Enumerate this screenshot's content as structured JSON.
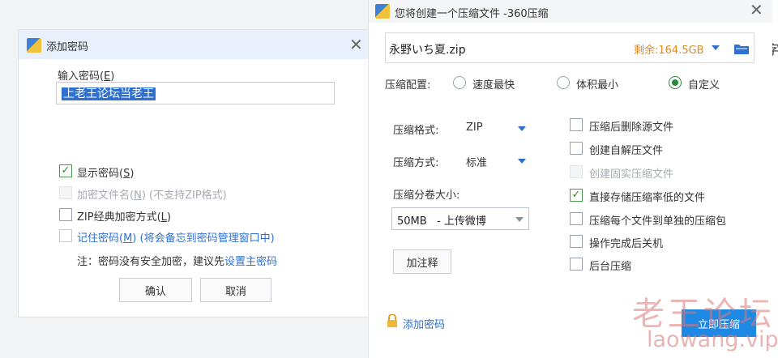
{
  "password_dialog": {
    "title": "添加密码",
    "input_label": "输入密码(",
    "input_label_key": "E",
    "input_label_end": ")",
    "password_value": "上老王论坛当老王",
    "options": [
      {
        "label": "显示密码(",
        "key": "S",
        "end": ")",
        "checked": true,
        "disabled": false
      },
      {
        "label": "加密文件名(",
        "key": "N",
        "end": ") (不支持ZIP格式)",
        "checked": false,
        "disabled": true
      },
      {
        "label": "ZIP经典加密方式(",
        "key": "L",
        "end": ")",
        "checked": false,
        "disabled": false
      },
      {
        "label": "记住密码(",
        "key": "M",
        "end": ") (将会备忘到密码管理窗口中)",
        "checked": false,
        "disabled": false,
        "link": true
      }
    ],
    "note_prefix": "注：密码没有安全加密，建议先",
    "note_link": "设置主密码",
    "ok_label": "确认",
    "cancel_label": "取消"
  },
  "zip_dialog": {
    "title": "您将创建一个压缩文件 -360压缩",
    "filename": "永野いち夏.zip",
    "free_space": "剩余:164.5GB",
    "config_label": "压缩配置:",
    "config_options": [
      {
        "label": "速度最快",
        "selected": false
      },
      {
        "label": "体积最小",
        "selected": false
      },
      {
        "label": "自定义",
        "selected": true
      }
    ],
    "format_label": "压缩格式:",
    "format_value": "ZIP",
    "method_label": "压缩方式:",
    "method_value": "标准",
    "volume_label": "压缩分卷大小:",
    "volume_value": "50MB   - 上传微博",
    "comment_button": "加注释",
    "add_password": "添加密码",
    "start_button": "立即压缩",
    "right_options": [
      {
        "label": "压缩后删除源文件",
        "checked": false,
        "disabled": false
      },
      {
        "label": "创建自解压文件",
        "checked": false,
        "disabled": false
      },
      {
        "label": "创建固实压缩文件",
        "checked": false,
        "disabled": true
      },
      {
        "label": "直接存储压缩率低的文件",
        "checked": true,
        "disabled": false
      },
      {
        "label": "压缩每个文件到单独的压缩包",
        "checked": false,
        "disabled": false
      },
      {
        "label": "操作完成后关机",
        "checked": false,
        "disabled": false
      },
      {
        "label": "后台压缩",
        "checked": false,
        "disabled": false
      }
    ]
  },
  "background_fragment": "字",
  "watermark": {
    "line1": "老王论坛",
    "line2": "laowang.vip"
  },
  "colors": {
    "accent": "#1e88e5",
    "link": "#2f6fd0",
    "free_space": "#e08a1f",
    "check": "#2f8a36"
  }
}
